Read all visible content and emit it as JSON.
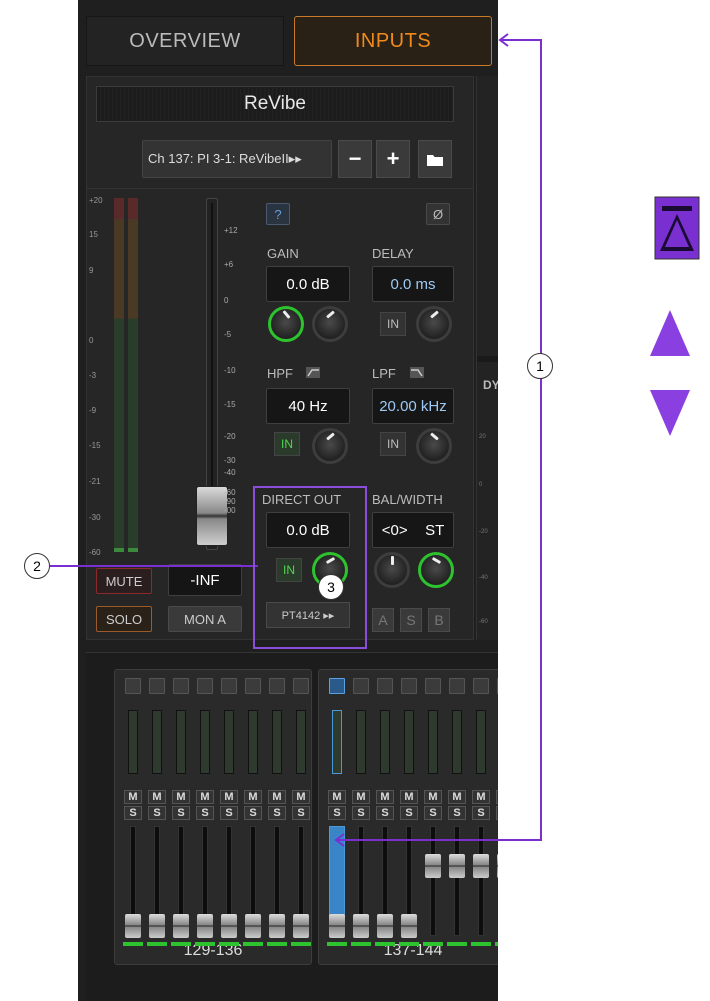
{
  "tabs": {
    "overview": "OVERVIEW",
    "inputs": "INPUTS"
  },
  "channel": {
    "name": "ReVibe",
    "selector": "Ch 137: PI 3-1: ReVibeII▸▸",
    "minus": "−",
    "plus": "+"
  },
  "meter_scale": [
    "+20",
    "15",
    "9",
    "0",
    "-3",
    "-9",
    "-15",
    "-21",
    "-30",
    "-60"
  ],
  "fader_scale": [
    "+12",
    "+6",
    "0",
    "-5",
    "-10",
    "-15",
    "-20",
    "-30",
    "-40",
    "-60",
    "-90",
    "-00"
  ],
  "buttons": {
    "help": "?",
    "phase": "Ø",
    "mute": "MUTE",
    "solo": "SOLO",
    "fader_value": "-INF",
    "mon": "MON A",
    "a": "A",
    "s": "S",
    "b": "B"
  },
  "gain": {
    "label": "GAIN",
    "value": "0.0 dB"
  },
  "delay": {
    "label": "DELAY",
    "value": "0.0 ms",
    "in": "IN"
  },
  "hpf": {
    "label": "HPF",
    "value": "40 Hz",
    "in": "IN"
  },
  "lpf": {
    "label": "LPF",
    "value": "20.00 kHz",
    "in": "IN"
  },
  "direct_out": {
    "label": "DIRECT OUT",
    "value": "0.0 dB",
    "in": "IN",
    "dest": "PT4142 ▸▸"
  },
  "bal_width": {
    "label": "BAL/WIDTH",
    "bal": "<0>",
    "width": "ST"
  },
  "right_strip": {
    "title": "DY",
    "scale": [
      "20",
      "0",
      "-20",
      "-40",
      "-60"
    ]
  },
  "banks": [
    {
      "label": "129-136"
    },
    {
      "label": "137-144"
    }
  ],
  "strip_buttons": {
    "m": "M",
    "s": "S"
  },
  "callouts": [
    "1",
    "2",
    "3"
  ],
  "colors": {
    "accent": "#f08a1c",
    "annotation": "#7a2fd0",
    "active_green": "#2ec22e",
    "selected_blue": "#3a85c7"
  }
}
